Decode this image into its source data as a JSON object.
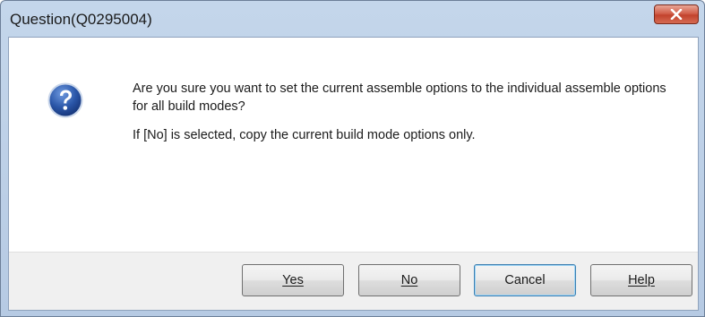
{
  "window": {
    "title": "Question(Q0295004)"
  },
  "message": {
    "line1": "Are you sure you want to set the current assemble options to the individual assemble options for all build modes?",
    "line2": "If [No] is selected, copy the current build mode options only."
  },
  "icon": {
    "name": "question-icon",
    "color": "#2a56a8"
  },
  "buttons": {
    "yes": "Yes",
    "no": "No",
    "cancel": "Cancel",
    "help": "Help"
  },
  "colors": {
    "close_button": "#c94a34",
    "titlebar": "#bfd1e8"
  }
}
